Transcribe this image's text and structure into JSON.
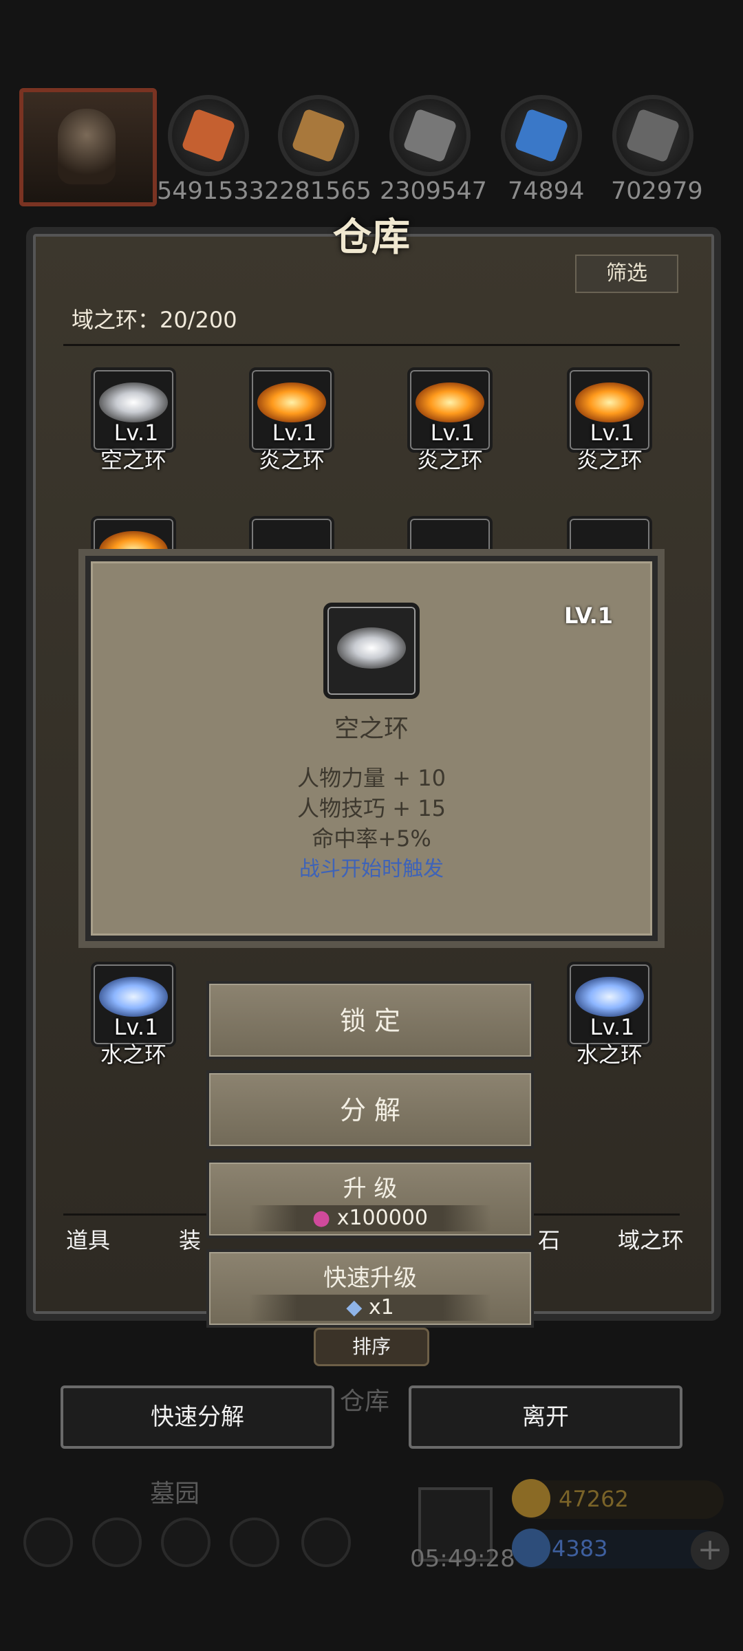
{
  "resources": {
    "values": [
      "5491533",
      "2281565",
      "2309547",
      "74894",
      "702979"
    ],
    "colors": [
      "#c56030",
      "#a8783c",
      "#777777",
      "#3a78c8",
      "#666666"
    ]
  },
  "warehouse": {
    "title": "仓库",
    "filter_label": "筛选",
    "capacity_label": "域之环：20/200"
  },
  "grid": {
    "row1": [
      {
        "level": "Lv.1",
        "name": "空之环",
        "element": "air"
      },
      {
        "level": "Lv.1",
        "name": "炎之环",
        "element": "fire"
      },
      {
        "level": "Lv.1",
        "name": "炎之环",
        "element": "fire"
      },
      {
        "level": "Lv.1",
        "name": "炎之环",
        "element": "fire"
      }
    ],
    "row_bottom": [
      {
        "level": "Lv.1",
        "name": "水之环",
        "element": "water"
      },
      {
        "level": "Lv.1",
        "name": "水之环",
        "element": "water"
      }
    ]
  },
  "tooltip": {
    "level": "LV.1",
    "name": "空之环",
    "stats": [
      "人物力量 + 10",
      "人物技巧 + 15",
      "命中率+5%"
    ],
    "trigger": "战斗开始时触发"
  },
  "actions": {
    "lock": "锁 定",
    "decompose": "分 解",
    "upgrade": "升 级",
    "upgrade_cost": "x100000",
    "quick_upgrade": "快速升级",
    "quick_upgrade_cost": "x1"
  },
  "tabs": [
    "道具",
    "装",
    "石",
    "域之环"
  ],
  "sort_label": "排序",
  "footer": {
    "quick_decompose": "快速分解",
    "leave": "离开",
    "bg_label_1": "仓库",
    "bg_label_2": "墓园",
    "gold": "47262",
    "gems": "4383",
    "timer": "05:49:28"
  },
  "colors": {
    "accent_gold": "#d9a341",
    "trigger_blue": "#3e63b8"
  }
}
